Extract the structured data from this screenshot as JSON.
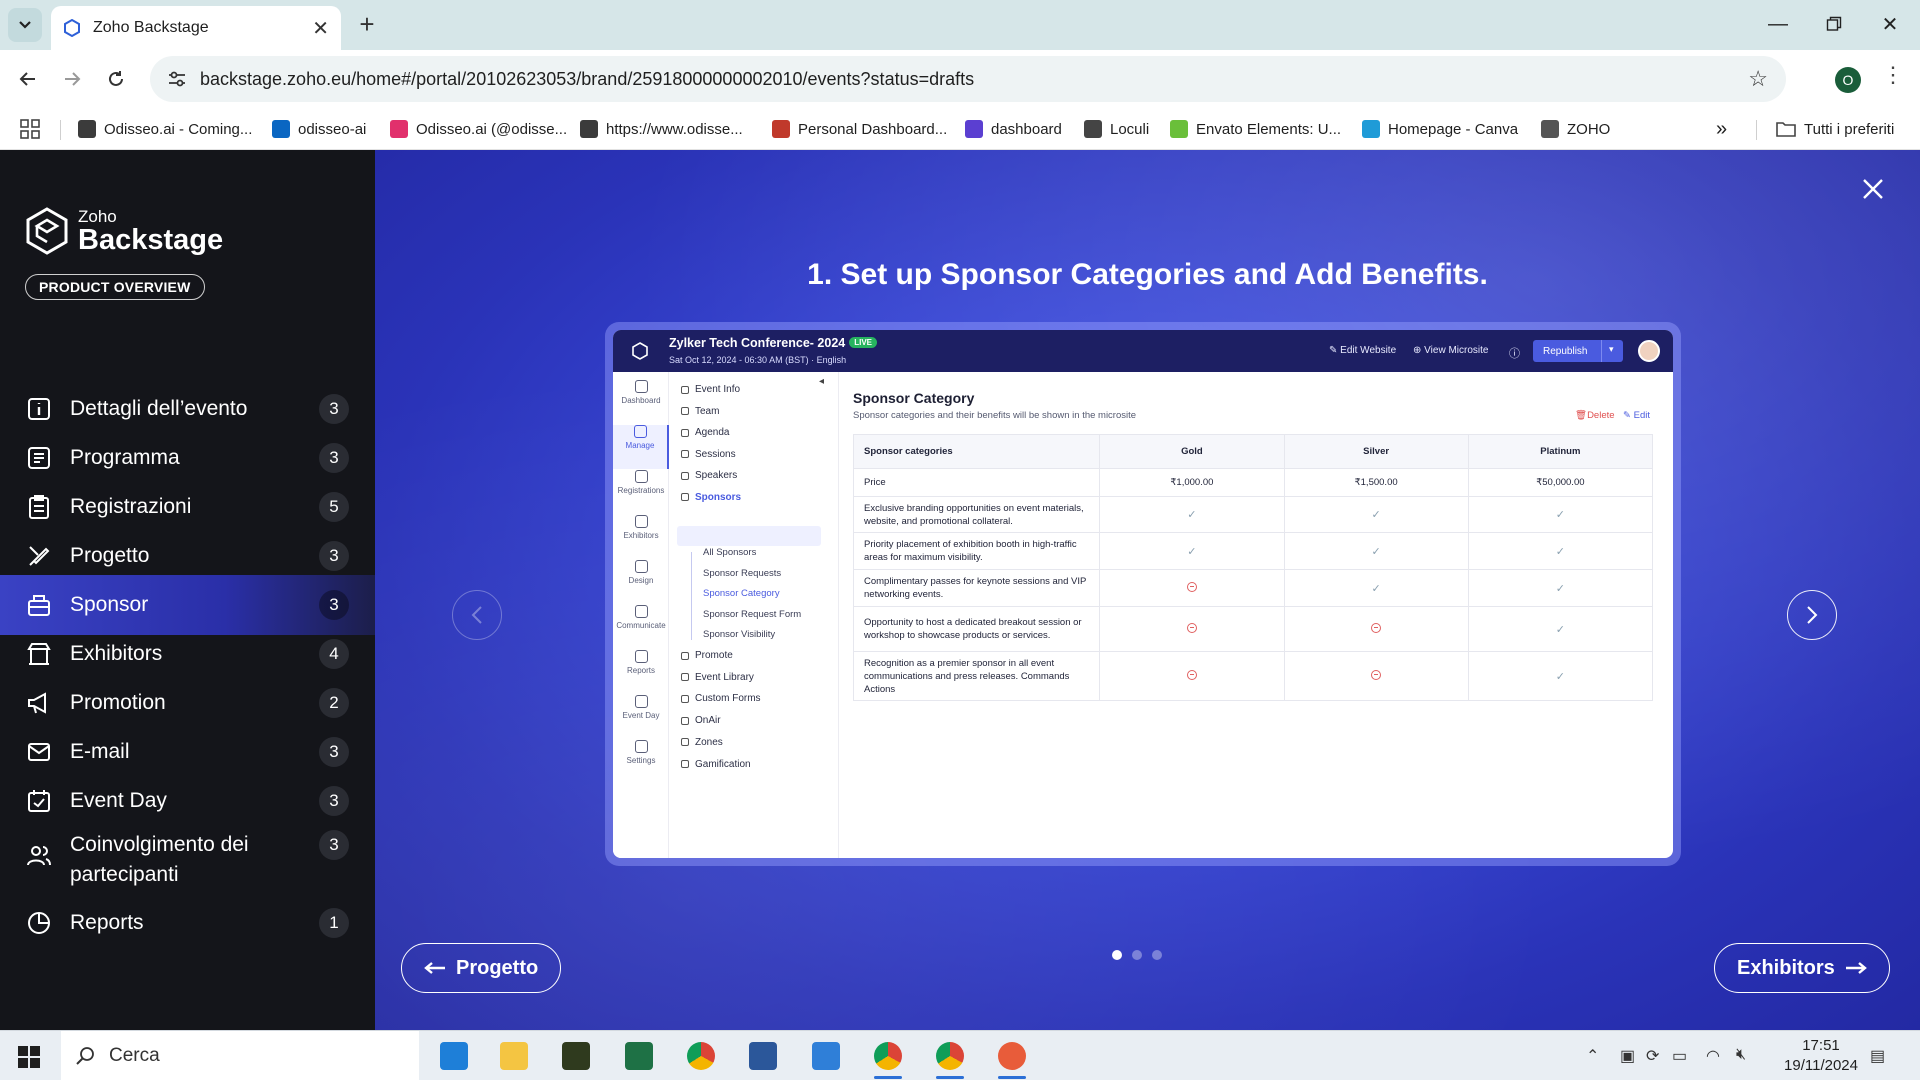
{
  "browser": {
    "tab_title": "Zoho Backstage",
    "url": "backstage.zoho.eu/home#/portal/20102623053/brand/25918000000002010/events?status=drafts",
    "profile_initial": "O",
    "bookmarks": [
      {
        "label": "Odisseo.ai - Coming...",
        "color": "#3b3b3b"
      },
      {
        "label": "odisseo-ai",
        "color": "#0a66c2"
      },
      {
        "label": "Odisseo.ai (@odisse...",
        "color": "#e1306c"
      },
      {
        "label": "https://www.odisse...",
        "color": "#3b3b3b"
      },
      {
        "label": "Personal Dashboard...",
        "color": "#c0392b"
      },
      {
        "label": "dashboard",
        "color": "#5b3fd1"
      },
      {
        "label": "Loculi",
        "color": "#444444"
      },
      {
        "label": "Envato Elements: U...",
        "color": "#6abf3a"
      },
      {
        "label": "Homepage - Canva",
        "color": "#1f9bd7"
      },
      {
        "label": "ZOHO",
        "color": "#555555"
      }
    ],
    "bookmarks_all": "Tutti i preferiti",
    "overflow": "»"
  },
  "sidebar": {
    "logo_zoho": "Zoho",
    "logo_product": "Backstage",
    "overview_button": "PRODUCT OVERVIEW",
    "items": [
      {
        "label": "Dettagli dell’evento",
        "count": "3",
        "icon": "info-icon"
      },
      {
        "label": "Programma",
        "count": "3",
        "icon": "agenda-icon"
      },
      {
        "label": "Registrazioni",
        "count": "5",
        "icon": "clipboard-icon"
      },
      {
        "label": "Progetto",
        "count": "3",
        "icon": "design-icon"
      },
      {
        "label": "Sponsor",
        "count": "3",
        "icon": "sponsor-icon"
      },
      {
        "label": "Exhibitors",
        "count": "4",
        "icon": "booth-icon"
      },
      {
        "label": "Promotion",
        "count": "2",
        "icon": "megaphone-icon"
      },
      {
        "label": "E-mail",
        "count": "3",
        "icon": "mail-icon"
      },
      {
        "label": "Event Day",
        "count": "3",
        "icon": "calendar-check-icon"
      },
      {
        "label": "Coinvolgimento dei partecipanti",
        "count": "3",
        "icon": "people-icon"
      },
      {
        "label": "Reports",
        "count": "1",
        "icon": "chart-pie-icon"
      }
    ],
    "active_index": 4
  },
  "main": {
    "title": "1. Set up Sponsor Categories and Add Benefits.",
    "prev_button": "Progetto",
    "next_button": "Exhibitors",
    "slides_total": 3,
    "slide_active": 1
  },
  "embedded": {
    "event_name": "Zylker Tech Conference- 2024",
    "live_badge": "LIVE",
    "event_sub": "Sat Oct 12, 2024 - 06:30 AM (BST)  ·  English",
    "edit_website": "Edit Website",
    "view_microsite": "View Microsite",
    "republish": "Republish",
    "rail": [
      "Dashboard",
      "Manage",
      "Registrations",
      "Exhibitors",
      "Design",
      "Communicate",
      "Reports",
      "Event Day",
      "Settings"
    ],
    "menu": [
      "Event Info",
      "Team",
      "Agenda",
      "Sessions",
      "Speakers",
      "Sponsors"
    ],
    "sponsor_sub": [
      "All Sponsors",
      "Sponsor Requests",
      "Sponsor Category",
      "Sponsor Request Form",
      "Sponsor Visibility"
    ],
    "menu_after": [
      "Promote",
      "Event Library",
      "Custom Forms",
      "OnAir",
      "Zones",
      "Gamification"
    ],
    "page_title": "Sponsor Category",
    "page_sub": "Sponsor categories and their benefits will be shown in the microsite",
    "delete": "Delete",
    "edit": "Edit",
    "table_header": [
      "Sponsor categories",
      "Gold",
      "Silver",
      "Platinum"
    ],
    "price_label": "Price",
    "prices": [
      "₹1,000.00",
      "₹1,500.00",
      "₹50,000.00"
    ],
    "benefits": [
      {
        "text": "Exclusive branding opportunities on event materials, website, and promotional collateral.",
        "gold": true,
        "silver": true,
        "platinum": true
      },
      {
        "text": "Priority placement of exhibition booth in high-traffic areas for maximum visibility.",
        "gold": true,
        "silver": true,
        "platinum": true
      },
      {
        "text": "Complimentary passes for keynote sessions and VIP networking events.",
        "gold": false,
        "silver": true,
        "platinum": true
      },
      {
        "text": "Opportunity to host a dedicated breakout session or workshop to showcase products or services.",
        "gold": false,
        "silver": false,
        "platinum": true
      },
      {
        "text": "Recognition as a premier sponsor in all event communications and press releases. Commands Actions",
        "gold": false,
        "silver": false,
        "platinum": true
      }
    ]
  },
  "taskbar": {
    "search_placeholder": "Cerca",
    "time": "17:51",
    "date": "19/11/2024"
  },
  "colors": {
    "sidebar_bg": "#14151a",
    "active_item": "#3a42c4",
    "main_bg": "#3847d6",
    "embedded_header": "#1d1f63",
    "accent": "#4a5bdf"
  }
}
